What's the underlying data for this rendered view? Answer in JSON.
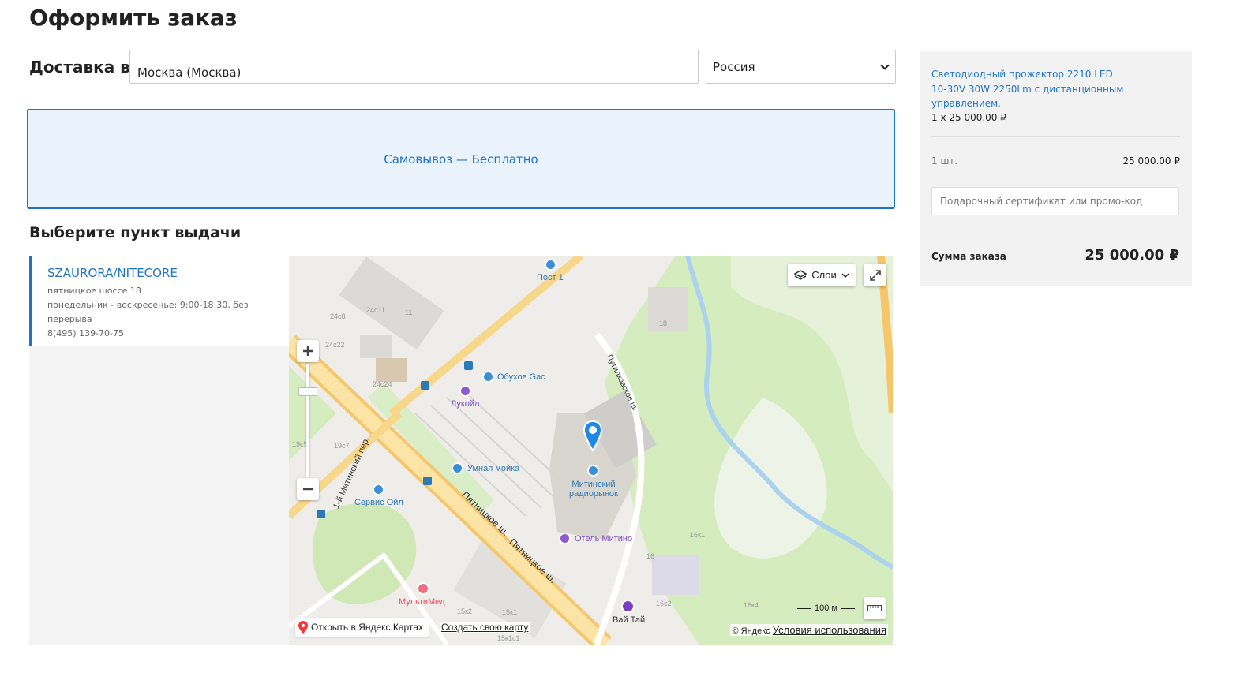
{
  "page": {
    "title": "Оформить заказ"
  },
  "delivery": {
    "label": "Доставка в",
    "city_value": "Москва (Москва)",
    "country_value": "Россия"
  },
  "pickup_option": {
    "label": "Самовывоз — Бесплатно"
  },
  "pickup_points": {
    "title": "Выберите пункт выдачи",
    "items": [
      {
        "name": "SZAURORA/NITECORE",
        "address": "пятницкое шоссе 18",
        "hours": "понедельник - воскресенье: 9:00-18:30, без перерыва",
        "phone": "8(495) 139-70-75"
      }
    ]
  },
  "map": {
    "layers_label": "Слои",
    "scale_label": "100 м",
    "open_in_yandex": "Открыть в Яндекс.Картах",
    "create_map": "Создать свою карту",
    "copyright": "© Яндекс",
    "terms": "Условия использования",
    "places": {
      "post1": "Пост 1",
      "obukhov_gas": "Обухов Gас",
      "lukoil": "Лукойл",
      "smart_wash": "Умная мойка",
      "service_oil": "Сервис Ойл",
      "mitino_market": "Митинский радиорынок",
      "hotel_mitino": "Отель Митино",
      "multimed": "МультиМед",
      "wai_thai": "Вай Тай"
    },
    "streets": {
      "pyatnitskoe_1": "Пятницкое ш.",
      "pyatnitskoe_2": "Пятницкое ш.",
      "mitinsky": "1-й Митинский пер.",
      "putilkovskoe": "Путилковское ш."
    },
    "buildings": [
      "24с8",
      "24с11",
      "11",
      "24с22",
      "24с24",
      "19с5",
      "19с7",
      "18",
      "16к1",
      "16",
      "16с2",
      "16к4",
      "15к2",
      "15к1",
      "15к1с1"
    ]
  },
  "summary": {
    "product_name": "Светодиодный прожектор 2210 LED 10-30V 30W 2250Lm с дистанционным управлением.",
    "product_qty_price": "1 x 25 000.00 ₽",
    "qty_label": "1 шт.",
    "qty_sum": "25 000.00 ₽",
    "promo_placeholder": "Подарочный сертификат или промо-код",
    "total_label": "Сумма заказа",
    "total_value": "25 000.00 ₽"
  },
  "colors": {
    "accent": "#1f74c8",
    "selected_bg": "#eaf2fc",
    "summary_bg": "#f2f2f2"
  }
}
